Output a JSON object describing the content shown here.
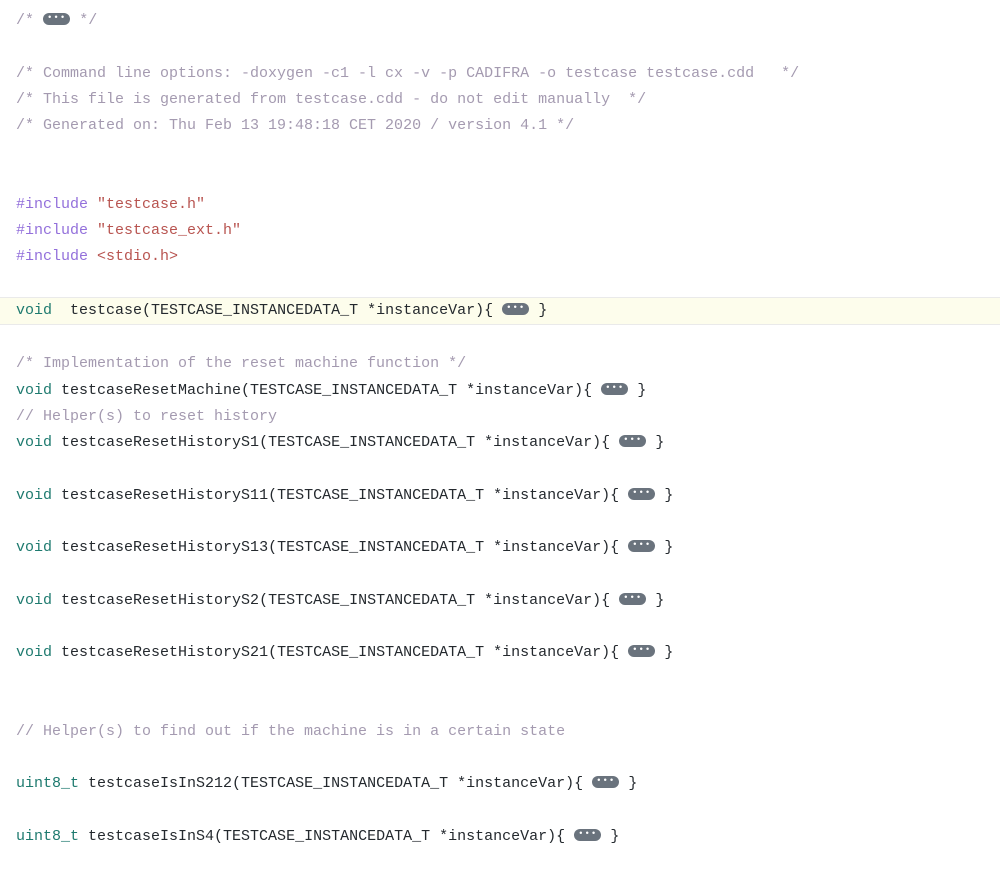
{
  "code": {
    "line01_open": "/* ",
    "line01_close": " */",
    "line02": "/* Command line options: -doxygen -c1 -l cx -v -p CADIFRA -o testcase testcase.cdd   */",
    "line03": "/* This file is generated from testcase.cdd - do not edit manually  */",
    "line04": "/* Generated on: Thu Feb 13 19:48:18 CET 2020 / version 4.1 */",
    "include_kw": "#include",
    "inc1": "\"testcase.h\"",
    "inc2": "\"testcase_ext.h\"",
    "inc3": "<stdio.h>",
    "void_kw": "void",
    "uint8_kw": "uint8_t",
    "space2": "  ",
    "space1": " ",
    "sig_testcase": "testcase(TESTCASE_INSTANCEDATA_T *instanceVar){ ",
    "brace_close": " }",
    "comm_reset_impl": "/* Implementation of the reset machine function */",
    "sig_resetMachine": "testcaseResetMachine(TESTCASE_INSTANCEDATA_T *instanceVar){ ",
    "comm_helper_reset": "// Helper(s) to reset history",
    "sig_resetS1": "testcaseResetHistoryS1(TESTCASE_INSTANCEDATA_T *instanceVar){ ",
    "sig_resetS11": "testcaseResetHistoryS11(TESTCASE_INSTANCEDATA_T *instanceVar){ ",
    "sig_resetS13": "testcaseResetHistoryS13(TESTCASE_INSTANCEDATA_T *instanceVar){ ",
    "sig_resetS2": "testcaseResetHistoryS2(TESTCASE_INSTANCEDATA_T *instanceVar){ ",
    "sig_resetS21": "testcaseResetHistoryS21(TESTCASE_INSTANCEDATA_T *instanceVar){ ",
    "comm_helper_state": "// Helper(s) to find out if the machine is in a certain state",
    "sig_isInS212": "testcaseIsInS212(TESTCASE_INSTANCEDATA_T *instanceVar){ ",
    "sig_isInS4": "testcaseIsInS4(TESTCASE_INSTANCEDATA_T *instanceVar){ "
  }
}
